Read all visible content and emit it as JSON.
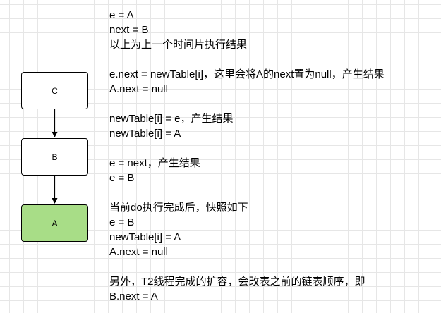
{
  "nodes": [
    {
      "id": "C",
      "label": "C",
      "fill": "#ffffff"
    },
    {
      "id": "B",
      "label": "B",
      "fill": "#ffffff"
    },
    {
      "id": "A",
      "label": "A",
      "fill": "#a8dd87"
    }
  ],
  "edges": [
    {
      "from": "C",
      "to": "B"
    },
    {
      "from": "B",
      "to": "A"
    }
  ],
  "notes": [
    [
      "e = A",
      "next = B",
      "以上为上一个时间片执行结果"
    ],
    [
      "e.next = newTable[i]，这里会将A的next置为null，产生结果",
      "A.next = null"
    ],
    [
      "newTable[i] = e，产生结果",
      "newTable[i] = A"
    ],
    [
      "e = next，产生结果",
      "e = B"
    ],
    [
      "当前do执行完成后，快照如下",
      "e = B",
      "newTable[i] = A",
      "A.next = null"
    ],
    [
      "另外，T2线程完成的扩容，会改表之前的链表顺序，即",
      "B.next = A"
    ]
  ]
}
